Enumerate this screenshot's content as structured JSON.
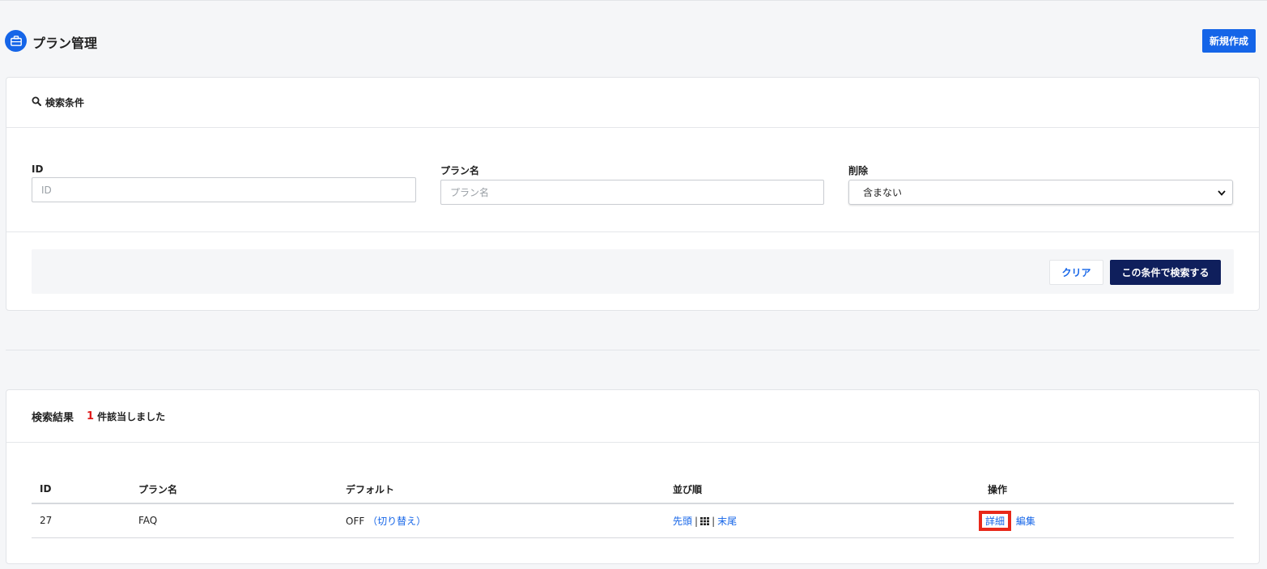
{
  "header": {
    "title": "プラン管理",
    "new_button": "新規作成"
  },
  "search": {
    "heading": "検索条件",
    "id_label": "ID",
    "id_placeholder": "ID",
    "plan_name_label": "プラン名",
    "plan_name_placeholder": "プラン名",
    "deleted_label": "削除",
    "deleted_selected": "含まない",
    "clear_button": "クリア",
    "search_button": "この条件で検索する"
  },
  "results": {
    "title": "検索結果",
    "count": "1",
    "count_suffix": "件該当しました",
    "columns": {
      "id": "ID",
      "name": "プラン名",
      "default": "デフォルト",
      "order": "並び順",
      "actions": "操作"
    },
    "rows": [
      {
        "id": "27",
        "name": "FAQ",
        "default": "OFF",
        "toggle": "（切り替え）",
        "order_first": "先頭",
        "order_last": "末尾",
        "detail": "詳細",
        "edit": "編集"
      }
    ]
  },
  "colors": {
    "primary": "#1565e8",
    "dark_button": "#0f1f5c",
    "count_red": "#e01b1b",
    "highlight": "#e8281a"
  }
}
